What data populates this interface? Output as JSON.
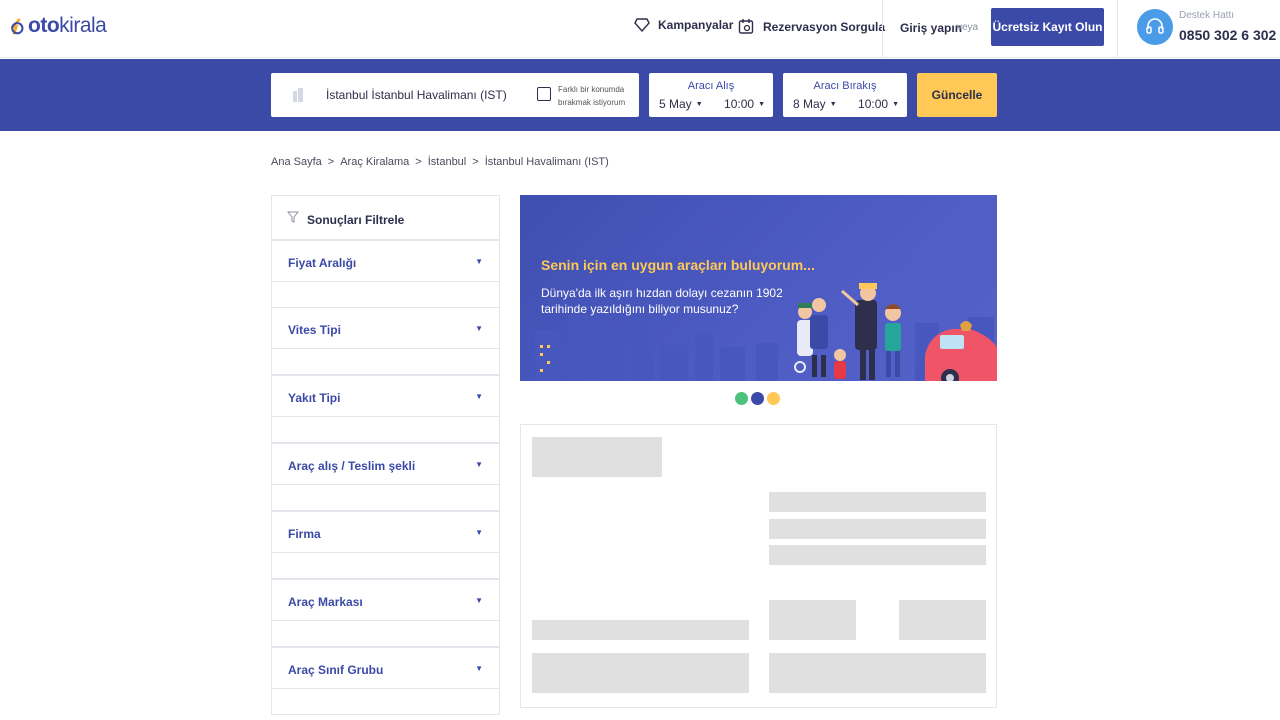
{
  "header": {
    "logo_oto": "oto",
    "logo_kirala": "kirala",
    "nav": [
      {
        "label": "Kampanyalar",
        "icon": "diamond-icon"
      },
      {
        "label": "Rezervasyon Sorgula",
        "icon": "calendar-search-icon"
      }
    ],
    "login_label": "Giriş yapın",
    "or_label": "veya",
    "register_label": "Ücretsiz Kayıt Olun",
    "support": {
      "label": "Destek Hattı",
      "phone": "0850 302 6 302",
      "icon": "headset-icon"
    }
  },
  "search": {
    "location": "İstanbul İstanbul Havalimanı (IST)",
    "different_location_label": "Farklı bir konumda bırakmak istiyorum",
    "pickup": {
      "title": "Aracı Alış",
      "date": "5 May",
      "time": "10:00"
    },
    "dropoff": {
      "title": "Aracı Bırakış",
      "date": "8 May",
      "time": "10:00"
    },
    "update_label": "Güncelle"
  },
  "breadcrumb": [
    "Ana Sayfa",
    "Araç Kiralama",
    "İstanbul",
    "İstanbul Havalimanı (IST)"
  ],
  "filters": {
    "title": "Sonuçları Filtrele",
    "items": [
      "Fiyat Aralığı",
      "Vites Tipi",
      "Yakıt Tipi",
      "Araç alış / Teslim şekli",
      "Firma",
      "Araç Markası",
      "Araç Sınıf Grubu"
    ]
  },
  "banner": {
    "heading": "Senin için en uygun araçları buluyorum...",
    "text": "Dünya'da ilk aşırı hızdan dolayı cezanın 1902 tarihinde yazıldığını biliyor musunuz?"
  },
  "colors": {
    "primary": "#3b4aa6",
    "accent": "#ffc857",
    "skeleton": "#e0e0e0"
  }
}
